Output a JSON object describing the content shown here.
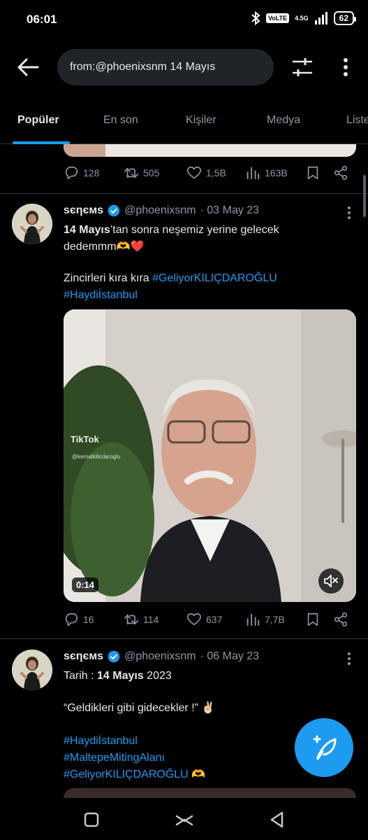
{
  "status_bar": {
    "time": "06:01",
    "volte": "VoLTE",
    "network": "4.5G",
    "battery": "62"
  },
  "search": {
    "query": "from:@phoenixsnm 14 Mayıs"
  },
  "tabs": [
    {
      "label": "Popüler",
      "active": true
    },
    {
      "label": "En son",
      "active": false
    },
    {
      "label": "Kişiler",
      "active": false
    },
    {
      "label": "Medya",
      "active": false
    },
    {
      "label": "Liste",
      "active": false
    }
  ],
  "prev_tweet": {
    "replies": "128",
    "retweets": "505",
    "likes": "1,5B",
    "views": "163B"
  },
  "tweet1": {
    "name": "ѕєηємѕ",
    "handle": "@phoenixsnm",
    "date": "· 03 May 23",
    "line1_bold": "14 Mayıs",
    "line1_rest": "’tan sonra neşemiz yerine gelecek",
    "line2": "dedemmm🫶❤️",
    "line3_text": "Zincirleri kıra kıra ",
    "line3_hashtag": "#GeliyorKILIÇDAROĞLU",
    "line4_hashtag": "#Haydiİstanbul",
    "video": {
      "duration": "0:14",
      "watermark": "TikTok",
      "watermark_handle": "@kemalkilicdaroglu"
    },
    "replies": "16",
    "retweets": "114",
    "likes": "637",
    "views": "7,7B"
  },
  "tweet2": {
    "name": "ѕєηємѕ",
    "handle": "@phoenixsnm",
    "date": "· 06 May 23",
    "line1_pre": "Tarih : ",
    "line1_bold": "14 Mayıs",
    "line1_post": " 2023",
    "line2": "“Geldikleri gibi gidecekler !” ✌🏻",
    "hashtag1": "#Haydiİstanbul",
    "hashtag2": "#MaltepeMitingAlanı",
    "hashtag3": "#GeliyorKILIÇDAROĞLU",
    "hashtag3_emoji": " 🫶"
  },
  "colors": {
    "accent": "#1d9bf0",
    "background": "#000000",
    "text": "#e7e9ea",
    "muted": "#8b98a5",
    "divider": "#2f3336"
  },
  "icons": {
    "back": "arrow-left-icon",
    "filter": "sliders-icon",
    "more": "more-vertical-icon",
    "reply": "reply-icon",
    "retweet": "retweet-icon",
    "like": "heart-icon",
    "views": "views-icon",
    "bookmark": "bookmark-icon",
    "share": "share-icon",
    "verified": "verified-badge-icon",
    "compose": "compose-feather-icon"
  }
}
